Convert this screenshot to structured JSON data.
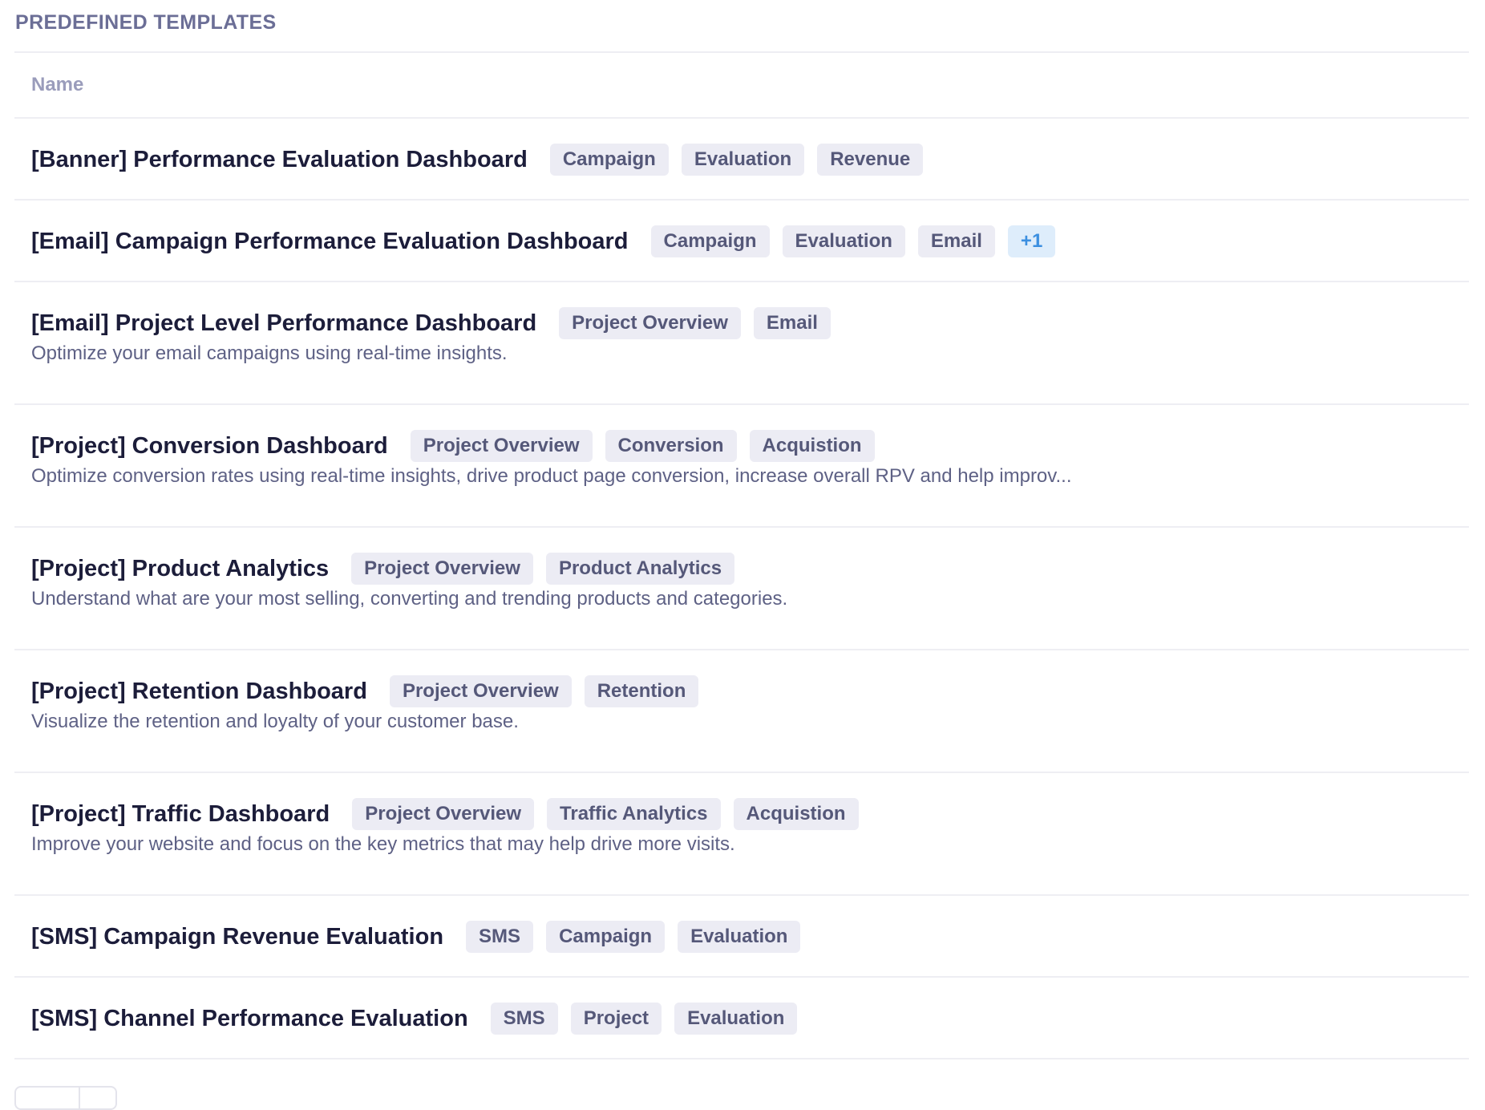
{
  "section": {
    "title": "PREDEFINED TEMPLATES"
  },
  "table": {
    "header": "Name"
  },
  "rows": [
    {
      "title": "[Banner] Performance Evaluation Dashboard",
      "tags": [
        "Campaign",
        "Evaluation",
        "Revenue"
      ],
      "more": "",
      "description": ""
    },
    {
      "title": "[Email] Campaign Performance Evaluation Dashboard",
      "tags": [
        "Campaign",
        "Evaluation",
        "Email"
      ],
      "more": "+1",
      "description": ""
    },
    {
      "title": "[Email] Project Level Performance Dashboard",
      "tags": [
        "Project Overview",
        "Email"
      ],
      "more": "",
      "description": "Optimize your email campaigns using real-time insights."
    },
    {
      "title": "[Project] Conversion Dashboard",
      "tags": [
        "Project Overview",
        "Conversion",
        "Acquistion"
      ],
      "more": "",
      "description": "Optimize conversion rates using real-time insights, drive product page conversion, increase overall RPV and help improv..."
    },
    {
      "title": "[Project] Product Analytics",
      "tags": [
        "Project Overview",
        "Product Analytics"
      ],
      "more": "",
      "description": "Understand what are your most selling, converting and trending products and categories."
    },
    {
      "title": "[Project] Retention Dashboard",
      "tags": [
        "Project Overview",
        "Retention"
      ],
      "more": "",
      "description": "Visualize the retention and loyalty of your customer base."
    },
    {
      "title": "[Project] Traffic Dashboard",
      "tags": [
        "Project Overview",
        "Traffic Analytics",
        "Acquistion"
      ],
      "more": "",
      "description": "Improve your website and focus on the key metrics that may help drive more visits."
    },
    {
      "title": "[SMS] Campaign Revenue Evaluation",
      "tags": [
        "SMS",
        "Campaign",
        "Evaluation"
      ],
      "more": "",
      "description": ""
    },
    {
      "title": "[SMS] Channel Performance Evaluation",
      "tags": [
        "SMS",
        "Project",
        "Evaluation"
      ],
      "more": "",
      "description": ""
    }
  ],
  "colors": {
    "tag_bg": "#ececf4",
    "tag_text": "#555879",
    "more_bg": "#deedfb",
    "more_text": "#3b8fe0",
    "section_title": "#6b6e96"
  }
}
